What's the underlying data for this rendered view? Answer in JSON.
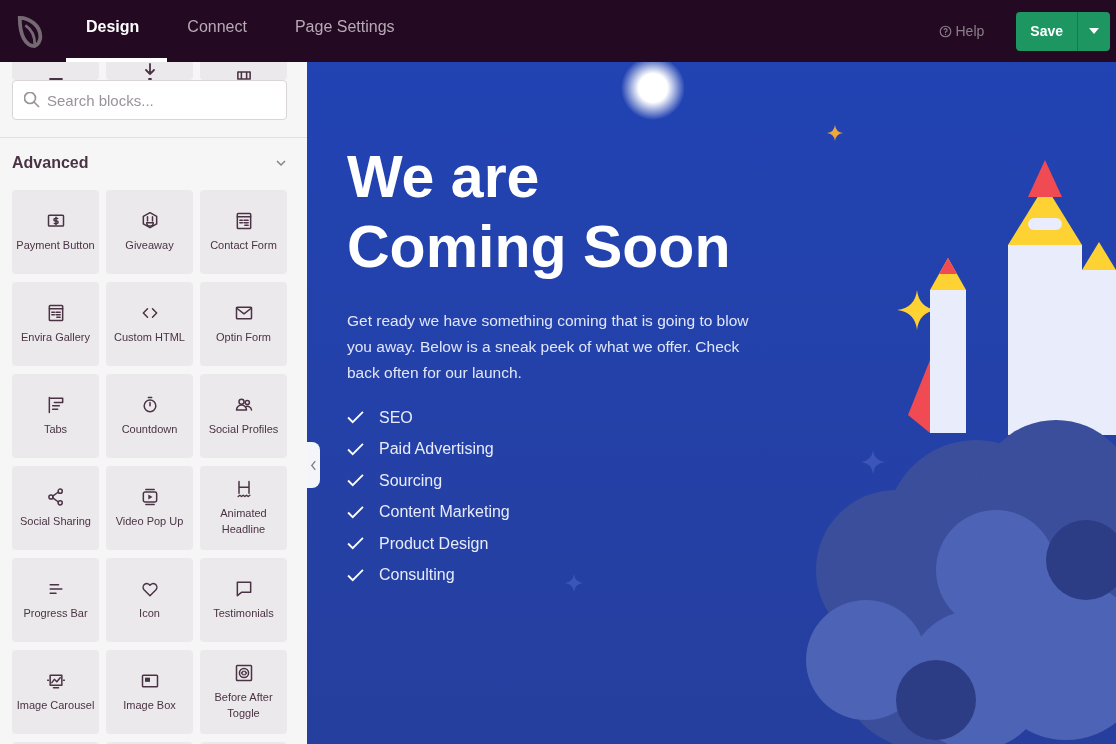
{
  "nav": {
    "tabs": [
      {
        "label": "Design",
        "selected": true
      },
      {
        "label": "Connect",
        "selected": false
      },
      {
        "label": "Page Settings",
        "selected": false
      }
    ],
    "help": "Help",
    "save": "Save"
  },
  "sidebar": {
    "search": {
      "placeholder": "Search blocks..."
    },
    "section": {
      "title": "Advanced",
      "expanded": true
    },
    "blocks": [
      "Payment Button",
      "Giveaway",
      "Contact Form",
      "Envira Gallery",
      "Custom HTML",
      "Optin Form",
      "Tabs",
      "Countdown",
      "Social Profiles",
      "Social Sharing",
      "Video Pop Up",
      "Animated Headline",
      "Progress Bar",
      "Icon",
      "Testimonials",
      "Image Carousel",
      "Image Box",
      "Before After Toggle"
    ]
  },
  "hero": {
    "heading": [
      "We are",
      "Coming Soon"
    ],
    "text": "Get ready we have something coming that is going to blow you away. Below is a sneak peek of what we offer. Check back often for our launch.",
    "features": [
      "SEO",
      "Paid Advertising",
      "Sourcing",
      "Content Marketing",
      "Product Design",
      "Consulting"
    ]
  }
}
